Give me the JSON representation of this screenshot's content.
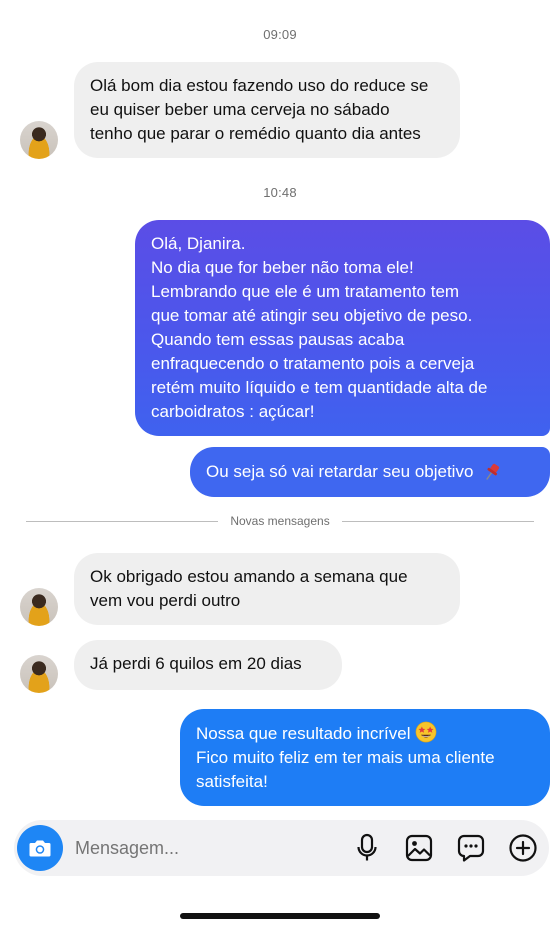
{
  "conversation": {
    "timestamps": [
      "09:09",
      "10:48"
    ],
    "messages": {
      "m1": "Olá bom dia estou fazendo uso do reduce se\neu quiser beber uma cerveja no sábado\ntenho que parar o remédio quanto dia antes",
      "m2": "Olá, Djanira.\nNo dia que for beber não toma ele!\nLembrando que ele é um tratamento tem\nque tomar até atingir seu objetivo de peso.\nQuando tem essas pausas acaba\nenfraquecendo o tratamento pois a cerveja\nretém muito líquido e tem quantidade alta de\ncarboidratos : açúcar!",
      "m3": "Ou seja só vai retardar seu objetivo",
      "m4": "Ok obrigado estou amando a semana que\nvem vou perdi outro",
      "m5": "Já perdi 6 quilos em 20 dias",
      "m6_line1": "Nossa que resultado incrível",
      "m6_rest": "Fico muito feliz em ter mais uma cliente\nsatisfeita!"
    },
    "divider_label": "Novas mensagens"
  },
  "composer": {
    "placeholder": "Mensagem...",
    "icons": [
      "camera-icon",
      "microphone-icon",
      "image-icon",
      "sticker-icon",
      "plus-icon"
    ]
  },
  "colors": {
    "incoming_bubble": "#efefef",
    "outgoing_gradient_top": "#5b4de6",
    "outgoing_gradient_bottom": "#3b6cf0",
    "outgoing_blue": "#1e7df5",
    "camera_button": "#1e86f5"
  },
  "emojis": [
    "pushpin",
    "star-struck"
  ]
}
